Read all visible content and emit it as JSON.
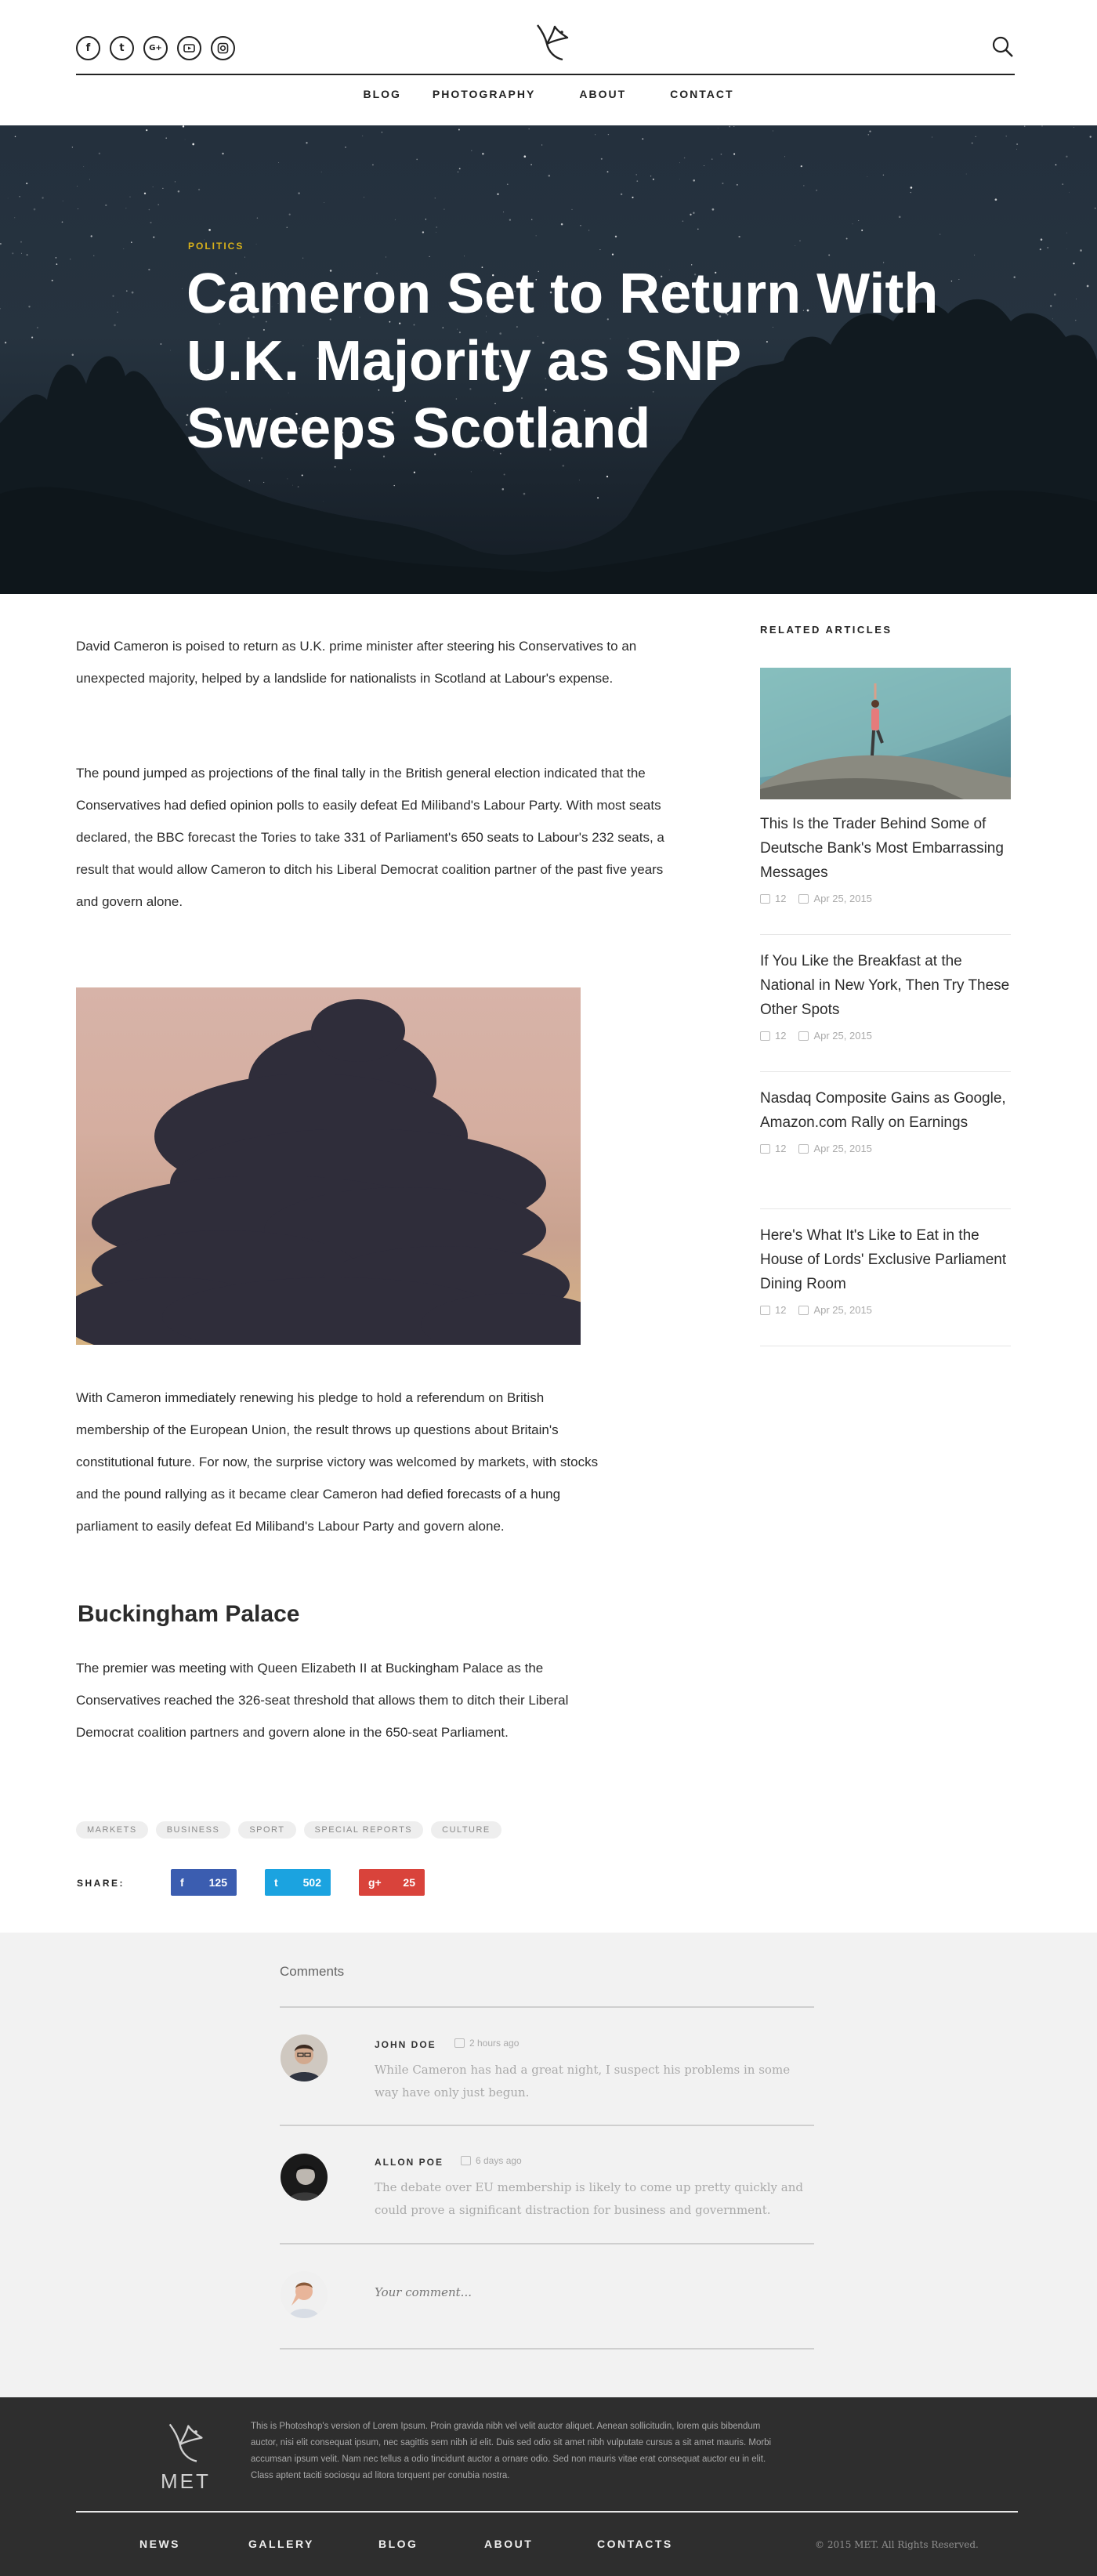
{
  "header": {
    "socials": [
      "f",
      "t",
      "G+",
      "yt",
      "ig"
    ],
    "nav": [
      "BLOG",
      "PHOTOGRAPHY",
      "ABOUT",
      "CONTACT"
    ]
  },
  "hero": {
    "category": "POLITICS",
    "title": "Cameron Set to Return With U.K. Majority as SNP Sweeps Scotland"
  },
  "article": {
    "paragraphs": [
      "David Cameron is poised to return as U.K. prime minister after steering his Conservatives to an unexpected majority, helped by a landslide for nationalists in Scotland at Labour's expense.",
      "The pound jumped as projections of the final tally in the British general election indicated that the Conservatives had defied opinion polls to easily defeat Ed Miliband's Labour Party. With most seats declared, the BBC forecast the Tories to take 331 of Parliament's 650 seats to Labour's 232 seats, a result that would allow Cameron to ditch his Liberal Democrat coalition partner of the past five years and govern alone.",
      "With Cameron immediately renewing his pledge to hold a referendum on British membership of the European Union, the result throws up questions about Britain's constitutional future. For now, the surprise victory was welcomed by markets, with stocks and the pound rallying as it became clear Cameron had defied forecasts of a hung parliament to easily defeat Ed Miliband's Labour Party and govern alone.",
      "The premier was meeting with Queen Elizabeth II at Buckingham Palace as the Conservatives reached the 326-seat threshold that allows them to ditch their Liberal Democrat coalition partners and govern alone in the 650-seat Parliament."
    ],
    "subheading": "Buckingham Palace",
    "tags": [
      "MARKETS",
      "BUSINESS",
      "SPORT",
      "SPECIAL REPORTS",
      "CULTURE"
    ],
    "share_label": "SHARE:",
    "share": {
      "facebook": {
        "icon": "f",
        "count": "125",
        "color": "#3b5db0"
      },
      "twitter": {
        "icon": "t",
        "count": "502",
        "color": "#1ba3e0"
      },
      "gplus": {
        "icon": "g+",
        "count": "25",
        "color": "#d9433b"
      }
    }
  },
  "sidebar": {
    "title": "RELATED ARTICLES",
    "items": [
      {
        "title": "This Is the Trader Behind Some of Deutsche Bank's Most Embarrassing Messages",
        "comments": "12",
        "date": "Apr 25, 2015"
      },
      {
        "title": "If You Like the Breakfast at the National in New York, Then Try These Other Spots",
        "comments": "12",
        "date": "Apr 25, 2015"
      },
      {
        "title": "Nasdaq Composite Gains as Google, Amazon.com Rally on Earnings",
        "comments": "12",
        "date": "Apr 25, 2015"
      },
      {
        "title": "Here's What It's Like to Eat in the House of Lords' Exclusive Parliament Dining Room",
        "comments": "12",
        "date": "Apr 25, 2015"
      }
    ]
  },
  "comments": {
    "heading": "Comments",
    "items": [
      {
        "name": "JOHN DOE",
        "time": "2 hours ago",
        "text": "While Cameron has had a great night, I suspect his problems in some way have only just begun."
      },
      {
        "name": "ALLON POE",
        "time": "6 days ago",
        "text": "The debate over EU membership is likely to come up pretty quickly and could prove a significant distraction for business and government."
      }
    ],
    "input_placeholder": "Your comment..."
  },
  "footer": {
    "brand": "MET",
    "text": "This is Photoshop's version of Lorem Ipsum. Proin gravida nibh vel velit auctor aliquet. Aenean sollicitudin, lorem quis bibendum auctor, nisi elit consequat ipsum, nec sagittis sem nibh id elit. Duis sed odio sit amet nibh vulputate cursus a sit amet mauris. Morbi accumsan ipsum velit. Nam nec tellus a odio tincidunt auctor a ornare odio. Sed non mauris vitae erat consequat auctor eu in elit. Class aptent taciti sociosqu ad litora torquent per conubia nostra.",
    "nav": [
      "NEWS",
      "GALLERY",
      "BLOG",
      "ABOUT",
      "CONTACTS"
    ],
    "copyright": "© 2015 MET. All Rights Reserved."
  },
  "colors": {
    "accent": "#d9b21a",
    "footer_bg": "#2e2e2e",
    "comments_bg": "#f2f2f2"
  }
}
